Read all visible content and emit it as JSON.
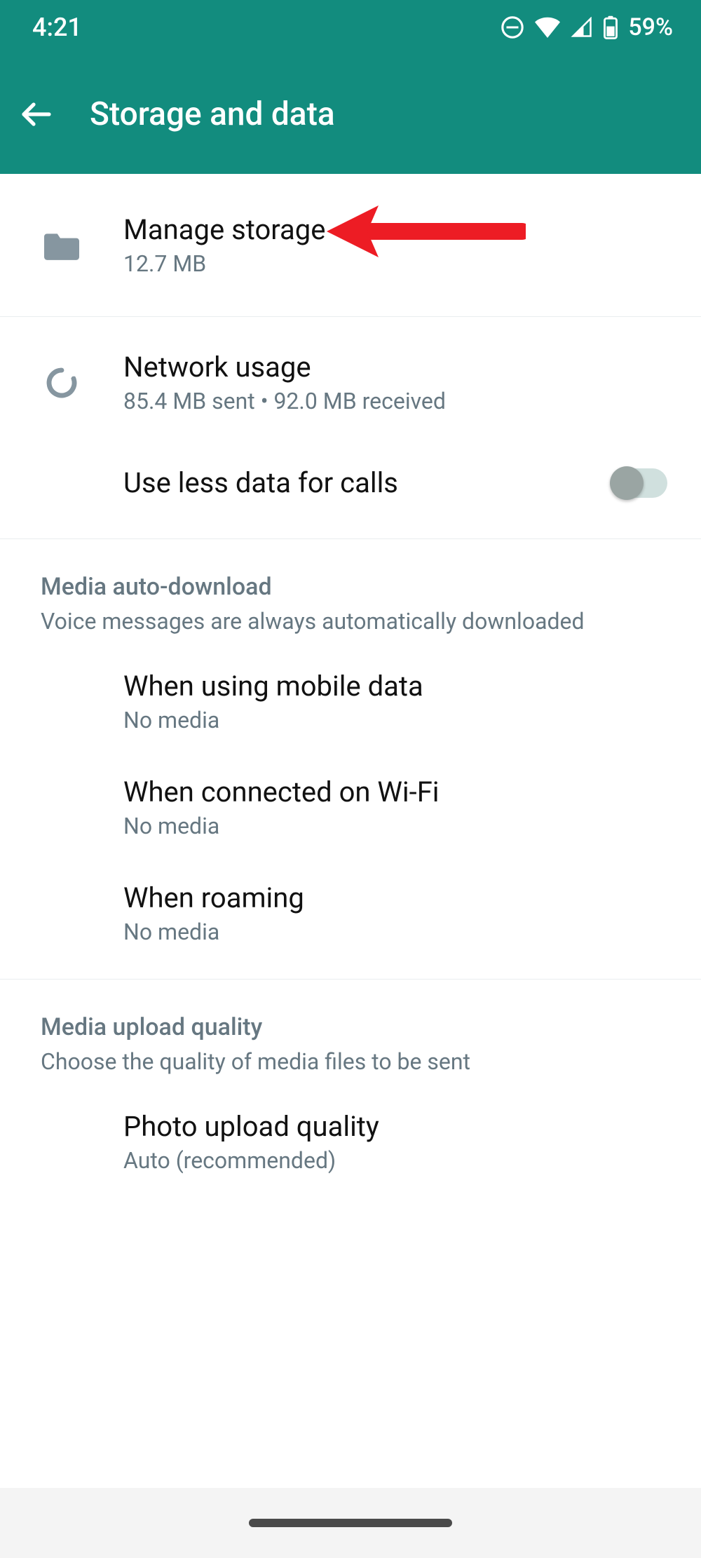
{
  "status": {
    "time": "4:21",
    "battery_pct": "59%"
  },
  "header": {
    "title": "Storage and data"
  },
  "storage": {
    "manage_title": "Manage storage",
    "manage_sub": "12.7 MB"
  },
  "network": {
    "usage_title": "Network usage",
    "usage_sub": "85.4 MB sent • 92.0 MB received",
    "less_data_title": "Use less data for calls",
    "less_data_on": false
  },
  "media_download": {
    "section_title": "Media auto-download",
    "section_desc": "Voice messages are always automatically downloaded",
    "mobile_title": "When using mobile data",
    "mobile_sub": "No media",
    "wifi_title": "When connected on Wi-Fi",
    "wifi_sub": "No media",
    "roaming_title": "When roaming",
    "roaming_sub": "No media"
  },
  "media_upload": {
    "section_title": "Media upload quality",
    "section_desc": "Choose the quality of media files to be sent",
    "photo_title": "Photo upload quality",
    "photo_sub": "Auto (recommended)"
  }
}
